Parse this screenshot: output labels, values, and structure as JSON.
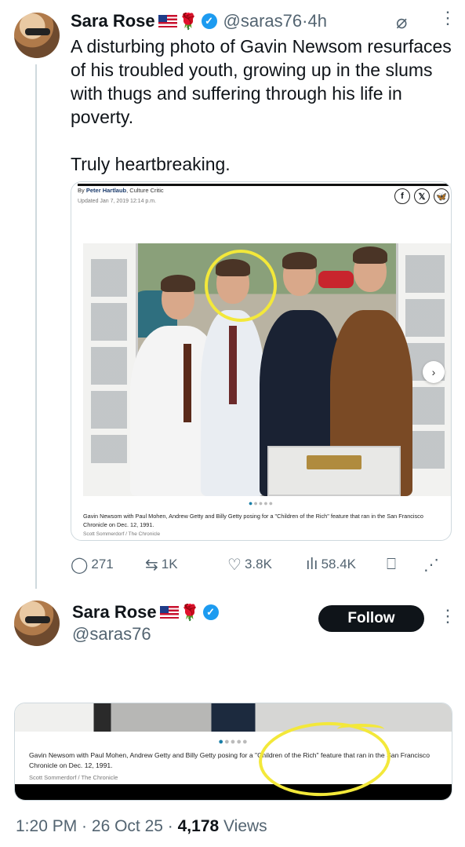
{
  "tweet1": {
    "author_name": "Sara Rose",
    "emoji_rose": "🌹",
    "handle": "@saras76",
    "time_sep": " · ",
    "time": "4h",
    "text": "A disturbing photo of Gavin Newsom resurfaces of his troubled youth, growing up in the slums with thugs and suffering through his life in poverty.\n\nTruly heartbreaking.",
    "card": {
      "byline_prefix": "By",
      "byline_author": "Peter Hartlaub",
      "byline_role": ", Culture Critic",
      "updated": "Updated Jan 7, 2019 12:14 p.m.",
      "social": [
        "f",
        "𝕏",
        "🦋"
      ],
      "next_label": "›",
      "caption": "Gavin Newsom with Paul Mohen, Andrew Getty and Billy Getty posing for a \"Children of the Rich\" feature that ran in the San Francisco Chronicle on Dec. 12, 1991.",
      "credit": "Scott Sommerdorf / The Chronicle"
    },
    "actions": {
      "replies": "271",
      "reposts": "1K",
      "likes": "3.8K",
      "views": "58.4K"
    }
  },
  "tweet2": {
    "author_name": "Sara Rose",
    "emoji_rose": "🌹",
    "handle": "@saras76",
    "follow_label": "Follow",
    "card": {
      "caption": "Gavin Newsom with Paul Mohen, Andrew Getty and Billy Getty posing for a \"Children of the Rich\" feature that ran in the San Francisco Chronicle on Dec. 12, 1991.",
      "credit": "Scott Sommerdorf / The Chronicle"
    },
    "footer": {
      "time": "1:20 PM",
      "sep1": " · ",
      "date": "26 Oct 25",
      "sep2": " · ",
      "views_count": "4,178",
      "views_label": " Views"
    }
  },
  "colors": {
    "verified": "#1d9bf0",
    "highlight": "#f3e83a",
    "follow_bg": "#0f1419",
    "muted": "#536471"
  },
  "icons": [
    "grok-icon",
    "more-icon",
    "reply-icon",
    "repost-icon",
    "like-icon",
    "views-icon",
    "bookmark-icon",
    "share-icon",
    "verified-icon",
    "us-flag-icon"
  ]
}
